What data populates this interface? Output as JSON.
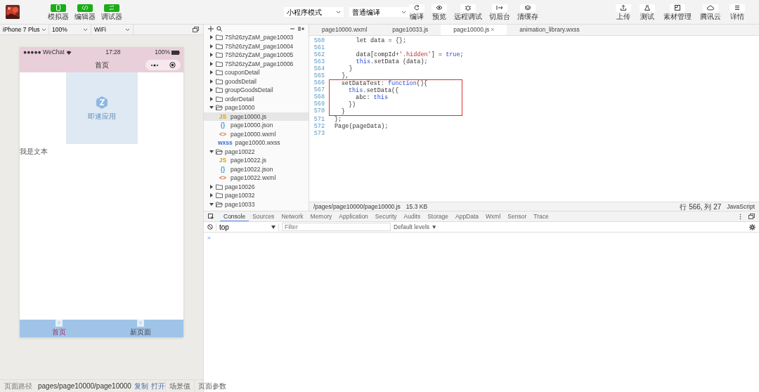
{
  "toolbar": {
    "mode_buttons": [
      {
        "label": "模拟器"
      },
      {
        "label": "编辑器"
      },
      {
        "label": "调试器"
      }
    ],
    "selects": [
      {
        "value": "小程序模式"
      },
      {
        "value": "普通编译"
      }
    ],
    "actions": [
      {
        "label": "编译"
      },
      {
        "label": "预览"
      },
      {
        "label": "远程调试"
      },
      {
        "label": "切后台"
      },
      {
        "label": "清缓存"
      }
    ],
    "right_actions": [
      {
        "label": "上传"
      },
      {
        "label": "测试"
      },
      {
        "label": "素材管理"
      },
      {
        "label": "腾讯云"
      },
      {
        "label": "详情"
      }
    ]
  },
  "simulator": {
    "device": "iPhone 7 Plus",
    "zoom": "100%",
    "network": "WiFi",
    "status_bar": {
      "carrier": "●●●●● WeChat",
      "time": "17:28",
      "battery": "100%"
    },
    "nav_title": "首页",
    "image_caption": "即速应用",
    "text": "我是文本",
    "tabs": [
      {
        "label": "首页",
        "selected": true
      },
      {
        "label": "新页面",
        "selected": false
      }
    ]
  },
  "page_path": {
    "label": "页面路径",
    "path": "pages/page10000/page10000",
    "links": [
      "复制",
      "打开"
    ],
    "buttons": [
      "场景值",
      "页面参数"
    ]
  },
  "file_tree": [
    {
      "name": "7Sh26zyZaM_page10003",
      "kind": "folder",
      "expanded": false,
      "selected": false
    },
    {
      "name": "7Sh26zyZaM_page10004",
      "kind": "folder",
      "expanded": false,
      "selected": false
    },
    {
      "name": "7Sh26zyZaM_page10005",
      "kind": "folder",
      "expanded": false,
      "selected": false
    },
    {
      "name": "7Sh26zyZaM_page10006",
      "kind": "folder",
      "expanded": false,
      "selected": false
    },
    {
      "name": "couponDetail",
      "kind": "folder",
      "expanded": false,
      "selected": false
    },
    {
      "name": "goodsDetail",
      "kind": "folder",
      "expanded": false,
      "selected": false
    },
    {
      "name": "groupGoodsDetail",
      "kind": "folder",
      "expanded": false,
      "selected": false
    },
    {
      "name": "orderDetail",
      "kind": "folder",
      "expanded": false,
      "selected": false
    },
    {
      "name": "page10000",
      "kind": "folder",
      "expanded": true,
      "selected": false,
      "children": [
        {
          "name": "page10000.js",
          "kind": "file",
          "badge": "JS",
          "color": "#d4a017",
          "selected": true
        },
        {
          "name": "page10000.json",
          "kind": "file",
          "badge": "{}",
          "color": "#3aa0d8",
          "selected": false
        },
        {
          "name": "page10000.wxml",
          "kind": "file",
          "badge": "<>",
          "color": "#e0703a",
          "selected": false
        },
        {
          "name": "page10000.wxss",
          "kind": "file",
          "badge": "wxss",
          "color": "#3a6fd0",
          "selected": false
        }
      ]
    },
    {
      "name": "page10022",
      "kind": "folder",
      "expanded": true,
      "selected": false,
      "children": [
        {
          "name": "page10022.js",
          "kind": "file",
          "badge": "JS",
          "color": "#d4a017",
          "selected": false
        },
        {
          "name": "page10022.json",
          "kind": "file",
          "badge": "{}",
          "color": "#3aa0d8",
          "selected": false
        },
        {
          "name": "page10022.wxml",
          "kind": "file",
          "badge": "<>",
          "color": "#e0703a",
          "selected": false
        }
      ]
    },
    {
      "name": "page10026",
      "kind": "folder",
      "expanded": false,
      "selected": false
    },
    {
      "name": "page10032",
      "kind": "folder",
      "expanded": false,
      "selected": false
    },
    {
      "name": "page10033",
      "kind": "folder",
      "expanded": true,
      "selected": false
    }
  ],
  "editor_tabs": [
    {
      "label": "page10000.wxml",
      "selected": false
    },
    {
      "label": "page10033.js",
      "selected": false
    },
    {
      "label": "page10000.js",
      "selected": true,
      "close": "×"
    },
    {
      "label": "animation_library.wxss",
      "selected": false
    }
  ],
  "code_lines": [
    {
      "number": "560",
      "highlighted": false,
      "tokens": [
        {
          "text": "let data = {};",
          "kind": "plain"
        }
      ]
    },
    {
      "number": "561",
      "highlighted": false
    },
    {
      "number": "562",
      "highlighted": false,
      "tokens": [
        {
          "text": "data[compId+",
          "kind": "plain"
        },
        {
          "text": "'.hidden'",
          "kind": "string"
        },
        {
          "text": "] = ",
          "kind": "plain"
        },
        {
          "text": "true",
          "kind": "keyword"
        },
        {
          "text": ";",
          "kind": "plain"
        }
      ]
    },
    {
      "number": "563",
      "highlighted": false,
      "tokens": [
        {
          "text": "this",
          "kind": "keyword"
        },
        {
          "text": ".setData (data);",
          "kind": "plain"
        }
      ]
    },
    {
      "number": "564",
      "highlighted": false,
      "tokens": [
        {
          "text": "}",
          "kind": "plain"
        }
      ]
    },
    {
      "number": "565",
      "highlighted": false,
      "tokens": [
        {
          "text": "},",
          "kind": "plain"
        }
      ]
    },
    {
      "number": "566",
      "highlighted": true,
      "tokens": [
        {
          "text": "setDataTest: ",
          "kind": "plain"
        },
        {
          "text": "function",
          "kind": "keyword"
        },
        {
          "text": "(){",
          "kind": "plain"
        }
      ]
    },
    {
      "number": "567",
      "highlighted": true,
      "tokens": [
        {
          "text": "this",
          "kind": "keyword"
        },
        {
          "text": ".setData({",
          "kind": "plain"
        }
      ]
    },
    {
      "number": "568",
      "highlighted": true,
      "tokens": [
        {
          "text": "abc: ",
          "kind": "plain"
        },
        {
          "text": "this",
          "kind": "keyword"
        }
      ]
    },
    {
      "number": "569",
      "highlighted": true,
      "tokens": [
        {
          "text": "})",
          "kind": "plain"
        }
      ]
    },
    {
      "number": "570",
      "highlighted": true,
      "tokens": [
        {
          "text": "}",
          "kind": "plain"
        }
      ]
    },
    {
      "number": "571",
      "highlighted": false,
      "tokens": [
        {
          "text": "};",
          "kind": "plain"
        }
      ]
    },
    {
      "number": "572",
      "highlighted": false,
      "tokens": [
        {
          "text": "Page(pageData);",
          "kind": "plain"
        }
      ]
    },
    {
      "number": "573",
      "highlighted": false
    }
  ],
  "editor_status": {
    "path": "/pages/page10000/page10000.js",
    "size": "15.3 KB",
    "position": "行 566, 列 27",
    "language": "JavaScript"
  },
  "console": {
    "tabs": [
      {
        "label": "Console",
        "selected": true
      },
      {
        "label": "Sources",
        "selected": false
      },
      {
        "label": "Network",
        "selected": false
      },
      {
        "label": "Memory",
        "selected": false
      },
      {
        "label": "Application",
        "selected": false
      },
      {
        "label": "Security",
        "selected": false
      },
      {
        "label": "Audits",
        "selected": false
      },
      {
        "label": "Storage",
        "selected": false
      },
      {
        "label": "AppData",
        "selected": false
      },
      {
        "label": "Wxml",
        "selected": false
      },
      {
        "label": "Sensor",
        "selected": false
      },
      {
        "label": "Trace",
        "selected": false
      }
    ],
    "context": "top",
    "filter_placeholder": "Filter",
    "levels": "Default levels ▼",
    "prompt": ">"
  }
}
